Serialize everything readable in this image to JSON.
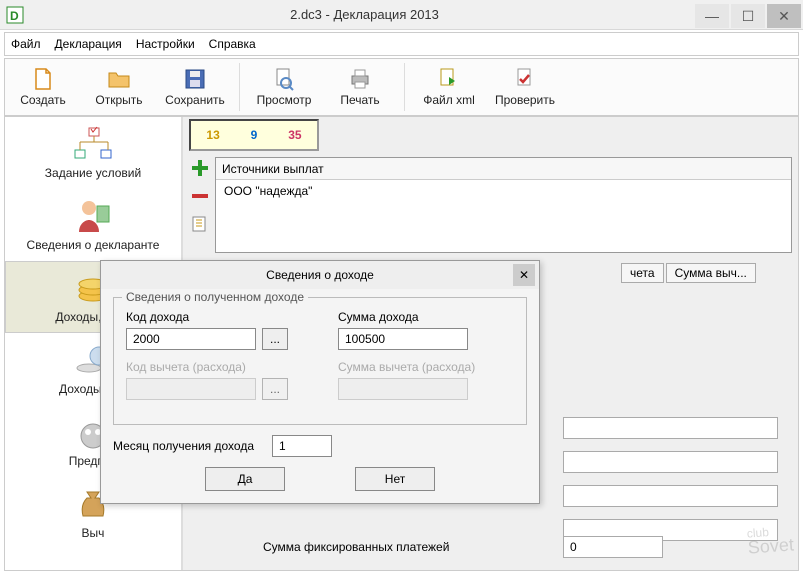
{
  "title": "2.dc3 - Декларация 2013",
  "menubar": {
    "file": "Файл",
    "decl": "Декларация",
    "settings": "Настройки",
    "help": "Справка"
  },
  "toolbar": {
    "create": "Создать",
    "open": "Открыть",
    "save": "Сохранить",
    "view": "Просмотр",
    "print": "Печать",
    "xml": "Файл xml",
    "check": "Проверить"
  },
  "sidebar": {
    "conditions": "Задание условий",
    "declarant": "Сведения о декларанте",
    "income": "Доходы, полу",
    "income_outside": "Доходы за п",
    "entrepreneur": "Предпри",
    "deductions": "Выч"
  },
  "numbers": {
    "a": "13",
    "b": "9",
    "c": "35"
  },
  "sources": {
    "header": "Источники выплат",
    "row1": "ООО \"надежда\""
  },
  "tabs": {
    "t1": "чета",
    "t2": "Сумма выч..."
  },
  "bottom": {
    "label": "Сумма фиксированных платежей",
    "value": "0"
  },
  "dialog": {
    "title": "Сведения о доходе",
    "groupTitle": "Сведения о полученном доходе",
    "codeLabel": "Код дохода",
    "codeValue": "2000",
    "ellipsis": "...",
    "sumLabel": "Сумма дохода",
    "sumValue": "100500",
    "dedCodeLabel": "Код вычета (расхода)",
    "dedSumLabel": "Сумма вычета (расхода)",
    "monthLabel": "Месяц получения дохода",
    "monthValue": "1",
    "yes": "Да",
    "no": "Нет"
  },
  "watermark": {
    "a": "club",
    "b": "Sovet"
  }
}
